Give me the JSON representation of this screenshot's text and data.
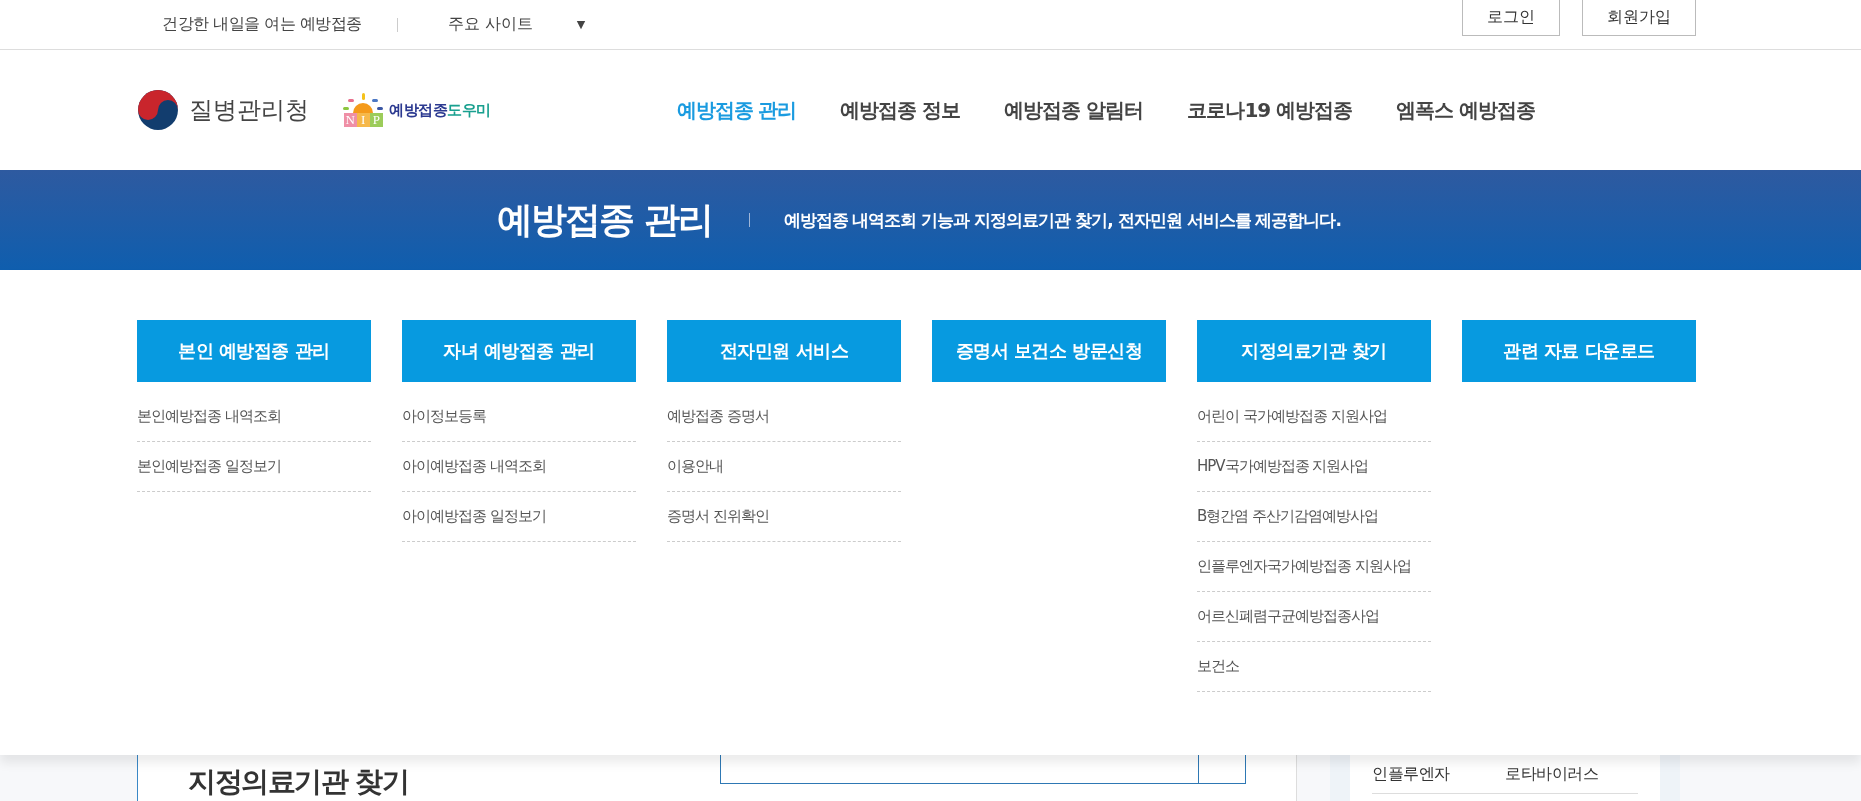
{
  "top_bar": {
    "tagline": "건강한 내일을 여는 예방접종",
    "site_select": {
      "label": "주요 사이트",
      "caret": "▼"
    },
    "buttons": [
      "로그인",
      "회원가입"
    ]
  },
  "header": {
    "agency_logo": {
      "text": "질병관리청"
    },
    "nip_logo": {
      "letters": [
        "N",
        "I",
        "P"
      ],
      "text_main": "예방접종",
      "text_accent": "도우미"
    },
    "nav": [
      {
        "label": "예방접종 관리",
        "selected": true
      },
      {
        "label": "예방접종 정보",
        "selected": false
      },
      {
        "label": "예방접종 알림터",
        "selected": false
      },
      {
        "label": "코로나19 예방접종",
        "selected": false
      },
      {
        "label": "엠폭스 예방접종",
        "selected": false
      }
    ]
  },
  "banner": {
    "title": "예방접종 관리",
    "description": "예방접종 내역조회 기능과 지정의료기관 찾기, 전자민원 서비스를 제공합니다."
  },
  "menu": {
    "columns": [
      {
        "title": "본인 예방접종 관리",
        "items": [
          "본인예방접종 내역조회",
          "본인예방접종 일정보기"
        ]
      },
      {
        "title": "자녀 예방접종 관리",
        "items": [
          "아이정보등록",
          "아이예방접종 내역조회",
          "아이예방접종 일정보기"
        ]
      },
      {
        "title": "전자민원 서비스",
        "items": [
          "예방접종 증명서",
          "이용안내",
          "증명서 진위확인"
        ]
      },
      {
        "title": "증명서 보건소 방문신청"
      },
      {
        "title": "지정의료기관 찾기",
        "items": [
          "어린이 국가예방접종 지원사업",
          "HPV국가예방접종 지원사업",
          "B형간염 주산기감염예방사업",
          "인플루엔자국가예방접종 지원사업",
          "어르신폐렴구균예방접종사업",
          "보건소"
        ]
      },
      {
        "title": "관련 자료 다운로드"
      }
    ]
  },
  "content": {
    "heading": "지정의료기관 찾기",
    "side_table": {
      "rows": [
        [
          "인플루엔자",
          "로타바이러스"
        ]
      ]
    }
  }
}
